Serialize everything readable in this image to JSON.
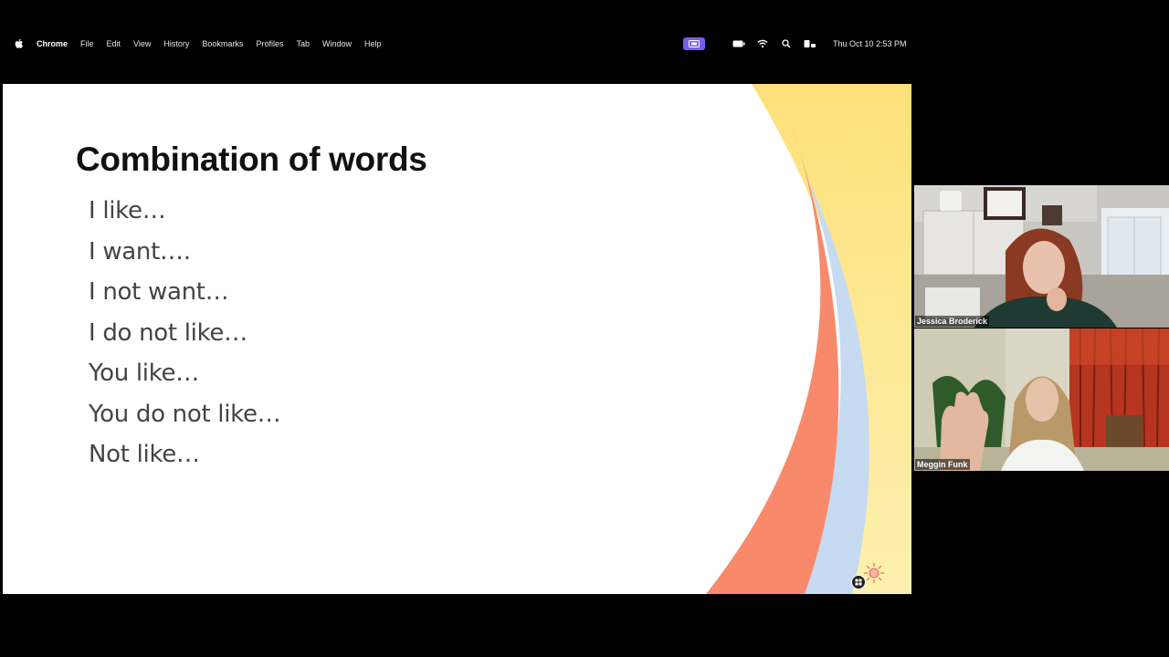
{
  "menubar": {
    "app_name": "Chrome",
    "items": [
      "File",
      "Edit",
      "View",
      "History",
      "Bookmarks",
      "Profiles",
      "Tab",
      "Window",
      "Help"
    ],
    "clock": "Thu Oct 10  2:53 PM",
    "icons": [
      "screen-share-icon",
      "battery-icon",
      "wifi-icon",
      "search-icon",
      "control-center-icon"
    ]
  },
  "slide": {
    "title": "Combination of words",
    "lines": [
      "I like…",
      "I want….",
      "I not want…",
      "I do not like…",
      "You like…",
      "You do not like…",
      "Not like…"
    ]
  },
  "participants": [
    {
      "name": "Jessica Broderick"
    },
    {
      "name": "Meggin Funk"
    }
  ],
  "colors": {
    "accent_purple": "#7b5cf0",
    "slide_yellow": "#fde68a",
    "slide_orange": "#f98a6a",
    "slide_blue": "#bcd4f0"
  }
}
